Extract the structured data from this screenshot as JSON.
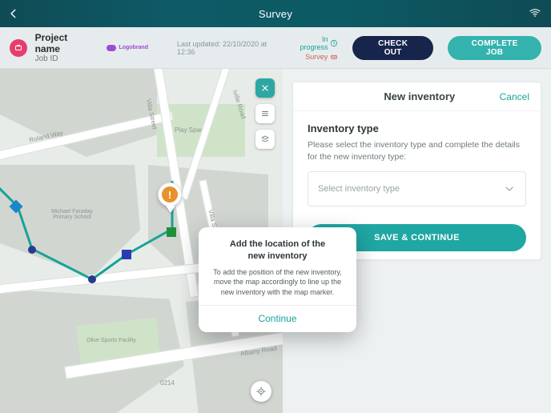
{
  "topnav": {
    "title": "Survey"
  },
  "header": {
    "project_name": "Project name",
    "job_id": "Job ID",
    "brand_label": "Logobrand",
    "last_updated": "Last updated: 22/10/2020 at 12:36",
    "status_in_progress": "In progress",
    "status_survey": "Survey",
    "checkout_label": "CHECK OUT",
    "complete_label": "COMPLETE JOB"
  },
  "panel": {
    "title": "New inventory",
    "cancel": "Cancel",
    "section_title": "Inventory type",
    "section_desc": "Please select the inventory type and complete the details for the new inventory type:",
    "select_placeholder": "Select inventory type",
    "save_label": "SAVE & CONTINUE"
  },
  "map": {
    "labels": {
      "roland": "Roland Way",
      "iville": "Iville Road",
      "villa1": "Villa Street",
      "villa2": "Villa Street",
      "albany": "Albany Road",
      "playspace": "Play Space",
      "school": "Michael Faraday Primary School",
      "sports": "Olive Sports Facility",
      "num": "0214"
    }
  },
  "modal": {
    "title_l1": "Add the location of the",
    "title_l2": "new inventory",
    "body": "To add the position of the new inventory, move the map accordingly to line up the new inventory with the map marker.",
    "continue": "Continue"
  }
}
